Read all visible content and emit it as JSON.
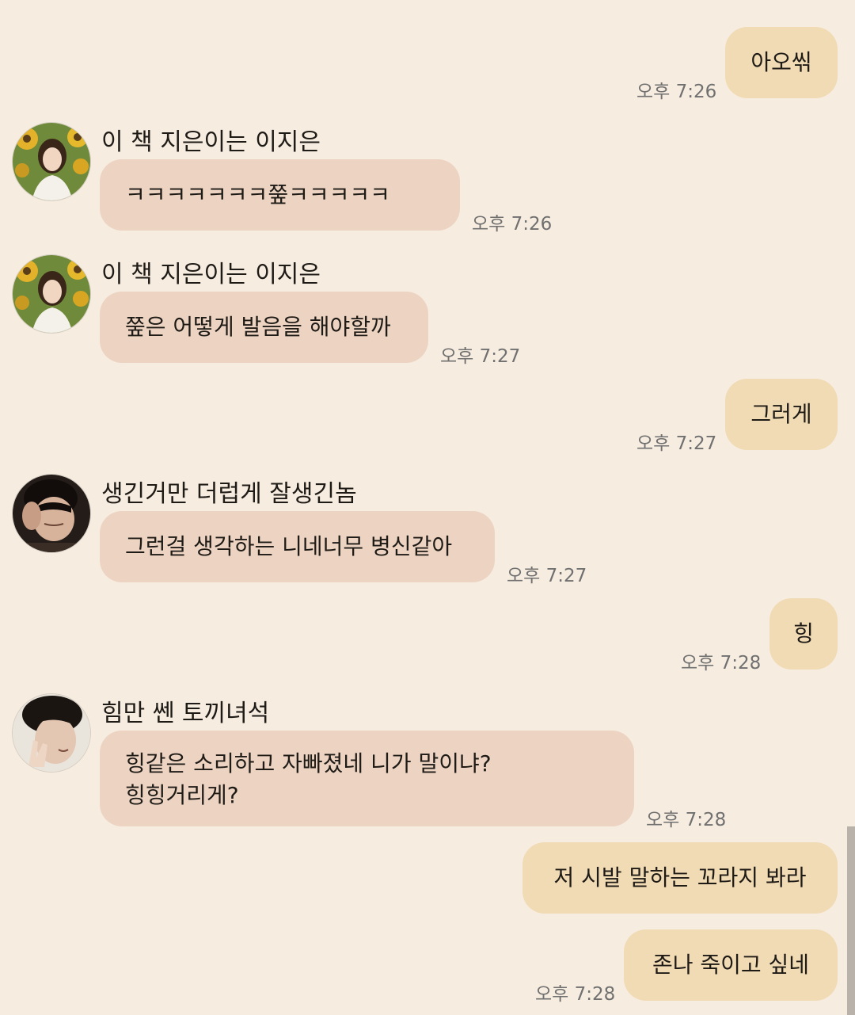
{
  "messages": [
    {
      "id": "m1",
      "from": "me",
      "text": "아오씪",
      "time": "오후 7:26"
    },
    {
      "id": "m2",
      "from": "them",
      "sender": "이 책 지은이는 이지은",
      "text": "ㅋㅋㅋㅋㅋㅋㅋ쭢ㅋㅋㅋㅋㅋ",
      "time": "오후 7:26",
      "avatar": "avatar-woman-sunflowers"
    },
    {
      "id": "m3",
      "from": "them",
      "sender": "이 책 지은이는 이지은",
      "text": "쭢은 어떻게 발음을 해야할까",
      "time": "오후 7:27",
      "avatar": "avatar-woman-sunflowers"
    },
    {
      "id": "m4",
      "from": "me",
      "text": "그러게",
      "time": "오후 7:27"
    },
    {
      "id": "m5",
      "from": "them",
      "sender": "생긴거만 더럽게 잘생긴놈",
      "text": "그런걸 생각하는 니네너무 병신같아",
      "time": "오후 7:27",
      "avatar": "avatar-man-dark"
    },
    {
      "id": "m6",
      "from": "me",
      "text": "힝",
      "time": "오후 7:28"
    },
    {
      "id": "m7",
      "from": "them",
      "sender": "힘만 쎈 토끼녀석",
      "text": "힝같은 소리하고 자빠졌네 니가 말이냐?\n힝힝거리게?",
      "time": "오후 7:28",
      "avatar": "avatar-man-hand"
    },
    {
      "id": "m8",
      "from": "me",
      "text": "저 시발 말하는 꼬라지 봐라",
      "time": ""
    },
    {
      "id": "m9",
      "from": "me",
      "text": "존나 죽이고 싶네",
      "time": "오후 7:28"
    }
  ]
}
